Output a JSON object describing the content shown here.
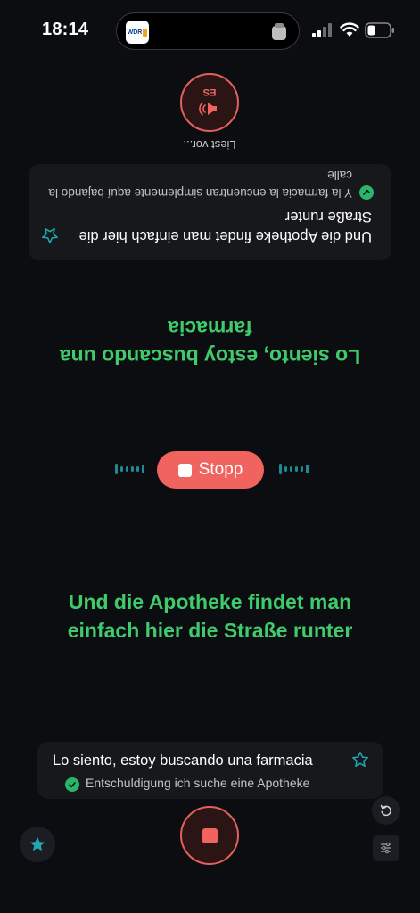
{
  "status_bar": {
    "time": "18:14",
    "app_badge": "WDR"
  },
  "listener_side": {
    "reading_label": "Liest vor...",
    "language_code": "ES",
    "card": {
      "main_text": "Und die Apotheke findet man einfach hier die Straße runter",
      "sub_text": "Y la farmacia la encuentran simplemente aquí bajando la calle"
    },
    "translation_big": "Lo siento, estoy buscando una farmacia"
  },
  "controls": {
    "stop_label": "Stopp"
  },
  "speaker_side": {
    "translation_big": "Und die Apotheke findet man einfach hier die Straße runter",
    "card": {
      "main_text": "Lo siento, estoy buscando una farmacia",
      "sub_text": "Entschuldigung ich suche eine Apotheke"
    }
  },
  "colors": {
    "accent_red": "#f0635e",
    "accent_green": "#3fca6b",
    "accent_teal": "#1f8a90",
    "background": "#0c0d10"
  }
}
